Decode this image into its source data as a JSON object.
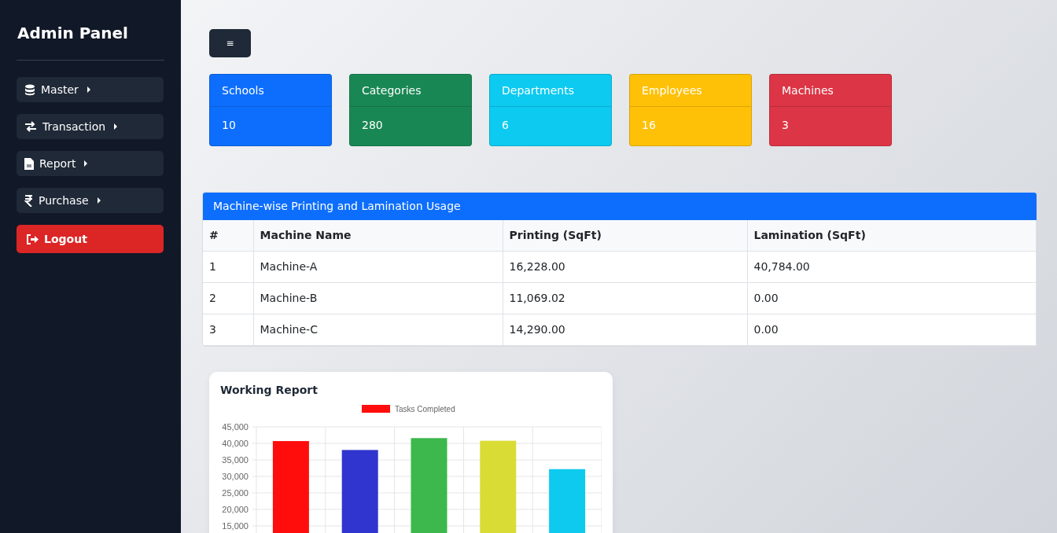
{
  "sidebar": {
    "title": "Admin Panel",
    "items": [
      {
        "label": "Master",
        "kind": "menu"
      },
      {
        "label": "Transaction",
        "kind": "menu"
      },
      {
        "label": "Report",
        "kind": "menu"
      },
      {
        "label": "Purchase",
        "kind": "menu"
      },
      {
        "label": "Logout",
        "kind": "logout"
      }
    ]
  },
  "toggle": {
    "label": "≡"
  },
  "stats": [
    {
      "label": "Schools",
      "value": "10",
      "color": "#0d6efd"
    },
    {
      "label": "Categories",
      "value": "280",
      "color": "#198754"
    },
    {
      "label": "Departments",
      "value": "6",
      "color": "#0dcaf0"
    },
    {
      "label": "Employees",
      "value": "16",
      "color": "#ffc107"
    },
    {
      "label": "Machines",
      "value": "3",
      "color": "#dc3545"
    }
  ],
  "usage_table": {
    "title": "Machine-wise Printing and Lamination Usage",
    "columns": [
      "#",
      "Machine Name",
      "Printing (SqFt)",
      "Lamination (SqFt)"
    ],
    "rows": [
      [
        "1",
        "Machine-A",
        "16,228.00",
        "40,784.00"
      ],
      [
        "2",
        "Machine-B",
        "11,069.02",
        "0.00"
      ],
      [
        "3",
        "Machine-C",
        "14,290.00",
        "0.00"
      ]
    ]
  },
  "working_report": {
    "title": "Working Report",
    "chart_data": {
      "type": "bar",
      "series": [
        {
          "name": "Tasks Completed",
          "color": [
            "#ff0d0d",
            "#3035cf",
            "#3cb84d",
            "#d9dc35",
            "#0ecaef"
          ],
          "values": [
            40700,
            38000,
            41600,
            40800,
            32200
          ]
        }
      ],
      "grid": true,
      "ylim": [
        0,
        45000
      ],
      "yticks": [
        {
          "value": 15000,
          "label": "15,000"
        },
        {
          "value": 20000,
          "label": "20,000"
        },
        {
          "value": 25000,
          "label": "25,000"
        },
        {
          "value": 30000,
          "label": "30,000"
        },
        {
          "value": 35000,
          "label": "35,000"
        },
        {
          "value": 40000,
          "label": "40,000"
        },
        {
          "value": 45000,
          "label": "45,000"
        }
      ]
    }
  }
}
